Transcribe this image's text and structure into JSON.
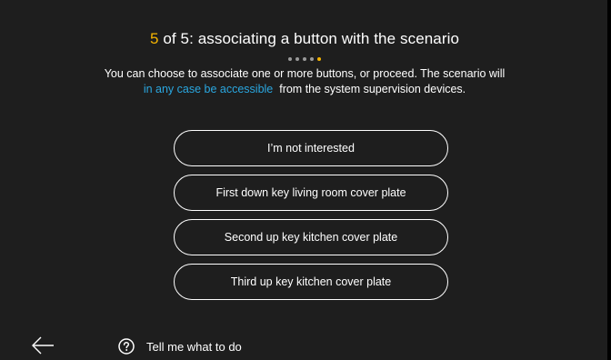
{
  "header": {
    "step_current": "5",
    "step_rest": " of 5: associating a button with the scenario",
    "progress": {
      "current": 5,
      "total": 5
    }
  },
  "description": {
    "line1": "You can choose to associate one or more buttons, or proceed. The scenario will",
    "link_text": "in any case be accessible",
    "line2_rest": "from the system supervision devices."
  },
  "options": [
    {
      "label": "I’m not interested"
    },
    {
      "label": "First down key living room cover plate"
    },
    {
      "label": "Second up key kitchen cover plate"
    },
    {
      "label": "Third up key kitchen cover plate"
    }
  ],
  "footer": {
    "back_icon": "arrow-left-icon",
    "help_icon": "question-circle-icon",
    "help_label": "Tell me what to do"
  },
  "colors": {
    "background": "#1e1e1e",
    "accent": "#f5b400",
    "link": "#2aa7e0",
    "text": "#ffffff"
  }
}
